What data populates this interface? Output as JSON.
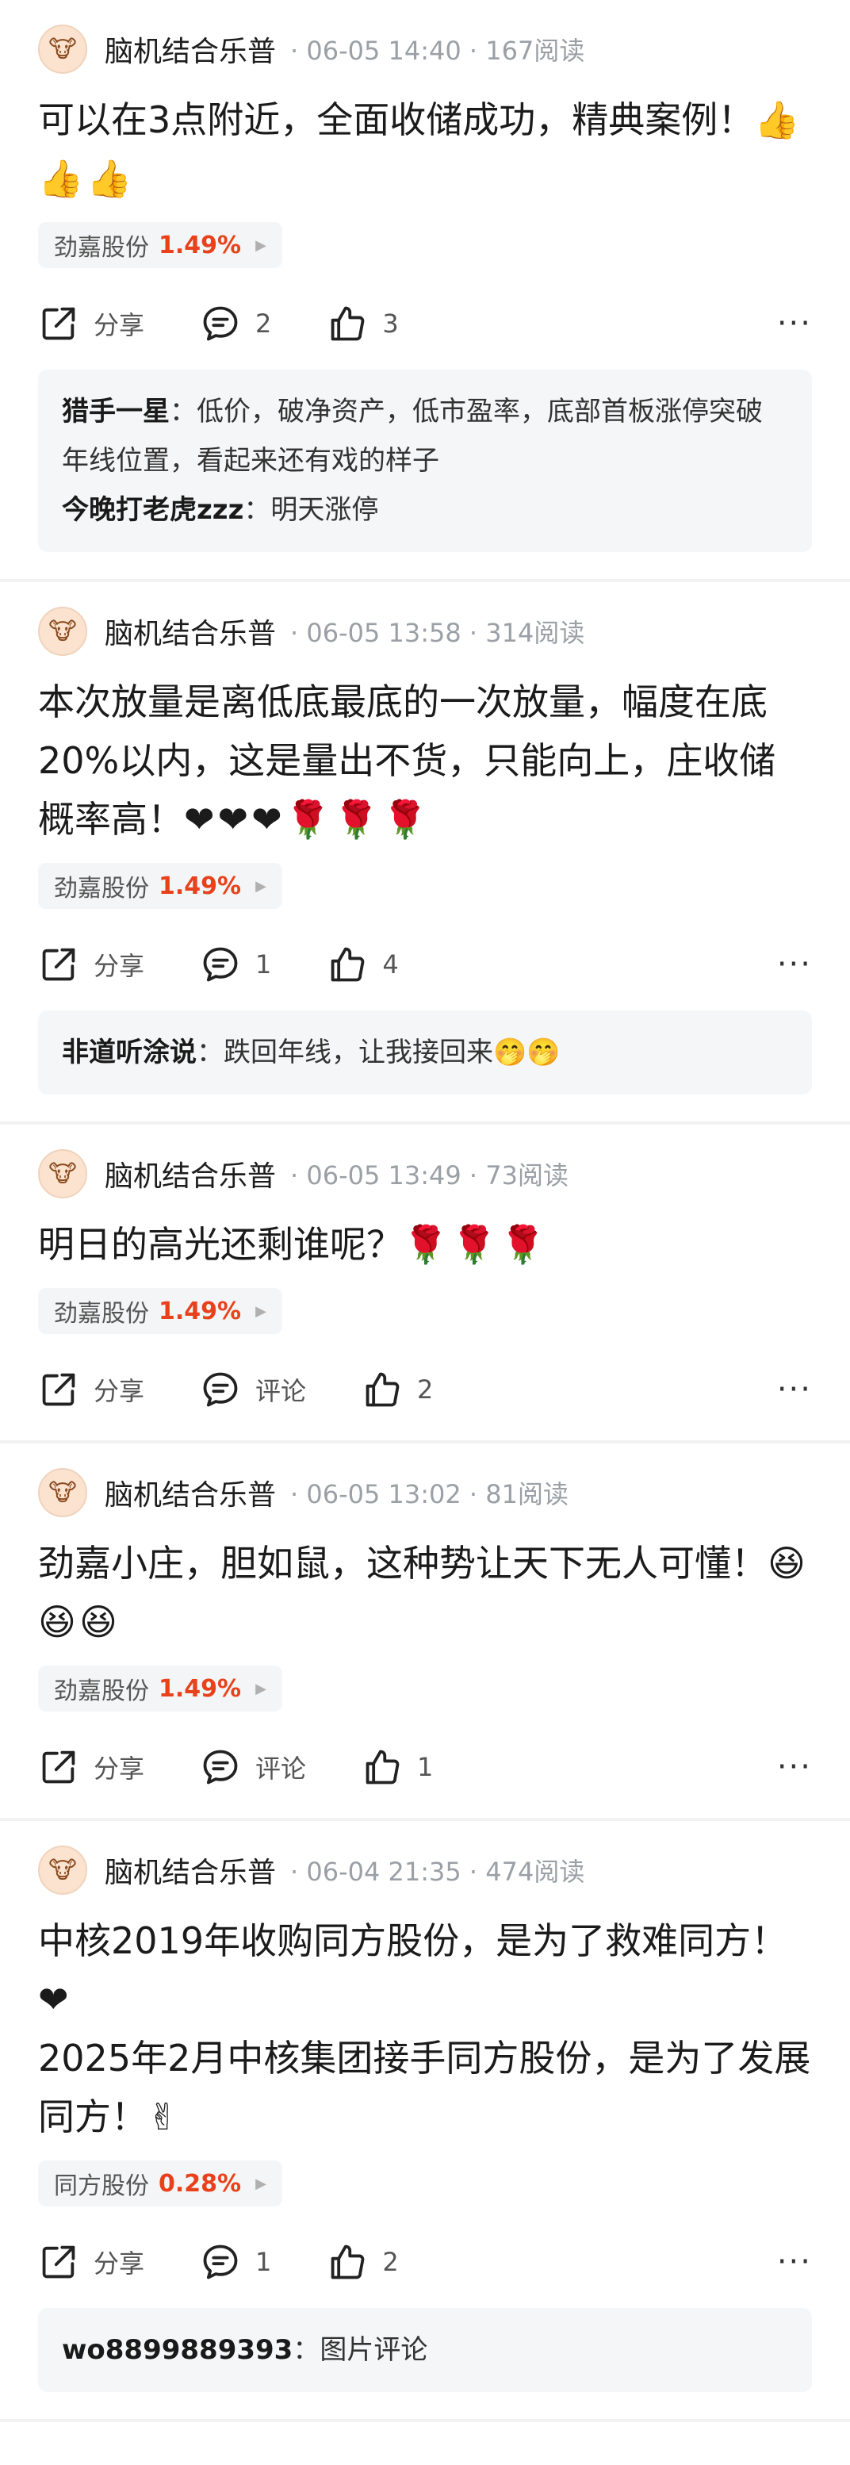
{
  "posts": [
    {
      "author": "脑机结合乐普",
      "meta": "· 06-05 14:40 · 167阅读",
      "content": "可以在3点附近，全面收储成功，精典案例！",
      "emoji": "👍👍👍",
      "stock": {
        "name": "劲嘉股份",
        "pct": "1.49%"
      },
      "share": "分享",
      "comments": "2",
      "likes": "3",
      "replies": [
        {
          "name": "猎手一星",
          "text": "：低价，破净资产，低市盈率，底部首板涨停突破年线位置，看起来还有戏的样子"
        },
        {
          "name": "今晚打老虎zzz",
          "text": "：明天涨停"
        }
      ]
    },
    {
      "author": "脑机结合乐普",
      "meta": "· 06-05 13:58 · 314阅读",
      "content": "本次放量是离低底最底的一次放量，幅度在底20%以内，这是量出不货，只能向上，庄收储概率高！",
      "emoji": "❤❤❤🌹🌹🌹",
      "stock": {
        "name": "劲嘉股份",
        "pct": "1.49%"
      },
      "share": "分享",
      "comments": "1",
      "likes": "4",
      "replies": [
        {
          "name": "非道听涂说",
          "text": "：跌回年线，让我接回来🤭🤭"
        }
      ]
    },
    {
      "author": "脑机结合乐普",
      "meta": "· 06-05 13:49 · 73阅读",
      "content": "明日的高光还剩谁呢？",
      "emoji": "🌹🌹🌹",
      "stock": {
        "name": "劲嘉股份",
        "pct": "1.49%"
      },
      "share": "分享",
      "comments": "评论",
      "likes": "2",
      "replies": []
    },
    {
      "author": "脑机结合乐普",
      "meta": "· 06-05 13:02 · 81阅读",
      "content": "劲嘉小庄，胆如鼠，这种势让天下无人可懂！",
      "emoji": "😆😆😆",
      "stock": {
        "name": "劲嘉股份",
        "pct": "1.49%"
      },
      "share": "分享",
      "comments": "评论",
      "likes": "1",
      "replies": []
    },
    {
      "author": "脑机结合乐普",
      "meta": "· 06-04 21:35 · 474阅读",
      "content": "中核2019年收购同方股份，是为了救难同方！❤\n2025年2月中核集团接手同方股份，是为了发展同方！",
      "emoji": "✌",
      "stock": {
        "name": "同方股份",
        "pct": "0.28%"
      },
      "share": "分享",
      "comments": "1",
      "likes": "2",
      "replies": [
        {
          "name": "wo8899889393",
          "text": "：图片评论"
        }
      ]
    }
  ]
}
